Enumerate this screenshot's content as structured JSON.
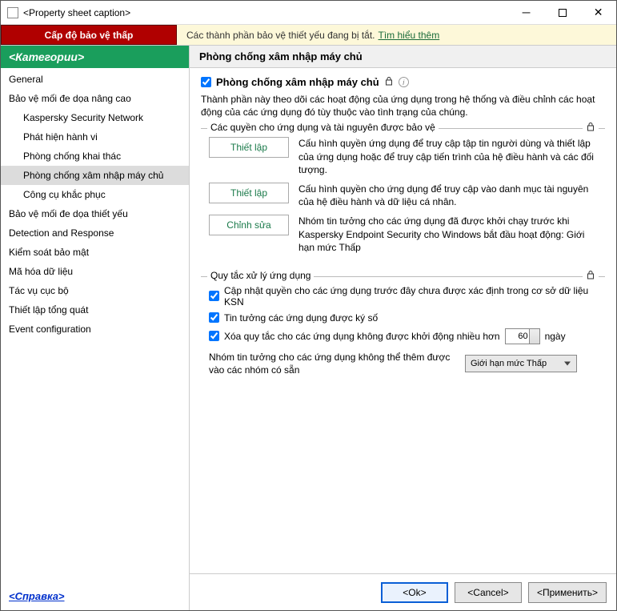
{
  "window": {
    "title": "<Property sheet caption>"
  },
  "warning": {
    "badge": "Cấp độ bảo vệ thấp",
    "text": "Các thành phần bảo vệ thiết yếu đang bị tắt.",
    "link": "Tìm hiểu thêm"
  },
  "sidebar": {
    "header": "<Категории>",
    "items": [
      {
        "label": "General",
        "sub": false,
        "active": false
      },
      {
        "label": "Bảo vệ mối đe dọa nâng cao",
        "sub": false,
        "active": false
      },
      {
        "label": "Kaspersky Security Network",
        "sub": true,
        "active": false
      },
      {
        "label": "Phát hiện hành vi",
        "sub": true,
        "active": false
      },
      {
        "label": "Phòng chống khai thác",
        "sub": true,
        "active": false
      },
      {
        "label": "Phòng chống xâm nhập máy chủ",
        "sub": true,
        "active": true
      },
      {
        "label": "Công cụ khắc phục",
        "sub": true,
        "active": false
      },
      {
        "label": "Bảo vệ mối đe dọa thiết yếu",
        "sub": false,
        "active": false
      },
      {
        "label": "Detection and Response",
        "sub": false,
        "active": false
      },
      {
        "label": "Kiểm soát bảo mật",
        "sub": false,
        "active": false
      },
      {
        "label": "Mã hóa dữ liệu",
        "sub": false,
        "active": false
      },
      {
        "label": "Tác vụ cục bộ",
        "sub": false,
        "active": false
      },
      {
        "label": "Thiết lập tổng quát",
        "sub": false,
        "active": false
      },
      {
        "label": "Event configuration",
        "sub": false,
        "active": false
      }
    ],
    "help": "<Справка>"
  },
  "main": {
    "header": "Phòng chống xâm nhập máy chủ",
    "feature_checkbox_label": "Phòng chống xâm nhập máy chủ",
    "description": "Thành phần này theo dõi các hoạt động của ứng dụng trong hệ thống và điều chỉnh các hoạt động của các ứng dụng đó tùy thuộc vào tình trạng của chúng.",
    "group1": {
      "legend": "Các quyền cho ứng dụng và tài nguyên được bảo vệ",
      "rows": [
        {
          "button": "Thiết lập",
          "text": "Cấu hình quyền ứng dụng để truy cập tập tin người dùng và thiết lập của ứng dụng hoặc để truy cập tiến trình của hệ điều hành và các đối tượng."
        },
        {
          "button": "Thiết lập",
          "text": "Cấu hình quyền cho ứng dụng để truy cập vào danh mục tài nguyên của hệ điều hành và dữ liệu cá nhân."
        },
        {
          "button": "Chỉnh sửa",
          "text": "Nhóm tin tưởng cho các ứng dụng đã được khởi chạy trước khi Kaspersky Endpoint Security cho Windows bắt đầu hoạt động: Giới hạn mức Thấp"
        }
      ]
    },
    "group2": {
      "legend": "Quy tắc xử lý ứng dụng",
      "chk1": "Cập nhật quyền cho các ứng dụng trước đây chưa được xác định trong cơ sở dữ liệu KSN",
      "chk2": "Tin tưởng các ứng dụng được ký số",
      "chk3_pre": "Xóa quy tắc cho các ứng dụng không được khởi động nhiều hơn",
      "chk3_value": "60",
      "chk3_post": "ngày",
      "trust_label": "Nhóm tin tưởng cho các ứng dụng không thể thêm được vào các nhóm có sẵn",
      "trust_value": "Giới hạn mức Thấp"
    }
  },
  "footer": {
    "ok": "<Ok>",
    "cancel": "<Cancel>",
    "apply": "<Применить>"
  }
}
